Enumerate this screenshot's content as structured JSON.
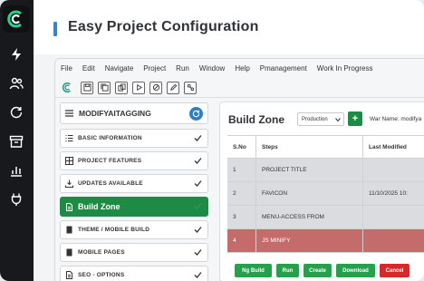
{
  "header": {
    "title": "Easy Project Configuration"
  },
  "menubar": [
    "File",
    "Edit",
    "Navigate",
    "Project",
    "Run",
    "Window",
    "Help",
    "Pmanagement",
    "Work In Progress"
  ],
  "sidebar": {
    "project_name": "MODIFYAITAGGING",
    "items": [
      {
        "label": "BASIC INFORMATION",
        "icon": "list-icon"
      },
      {
        "label": "PROJECT FEATURES",
        "icon": "grid-icon"
      },
      {
        "label": "UPDATES AVAILABLE",
        "icon": "download-icon"
      },
      {
        "label": "Build Zone",
        "icon": "document-icon",
        "active": true
      },
      {
        "label": "THEME / MOBILE BUILD",
        "icon": "document-icon"
      },
      {
        "label": "MOBILE PAGES",
        "icon": "document-icon"
      },
      {
        "label": "SEO - OPTIONS",
        "icon": "document-icon"
      }
    ]
  },
  "main": {
    "title": "Build Zone",
    "environment_select": "Production",
    "add_label": "+",
    "war_name_label": "War Name: modifya",
    "table": {
      "headers": [
        "S.No",
        "Steps",
        "Last Modified"
      ],
      "rows": [
        {
          "sno": "1",
          "step": "PROJECT TITLE",
          "modified": "",
          "status": "gray"
        },
        {
          "sno": "2",
          "step": "FAVICON",
          "modified": "11/10/2025 10:",
          "status": "gray"
        },
        {
          "sno": "3",
          "step": "MENU-ACCESS FROM",
          "modified": "",
          "status": "gray"
        },
        {
          "sno": "4",
          "step": "JS MINIFY",
          "modified": "",
          "status": "red"
        }
      ]
    },
    "actions": {
      "ng_build": "Ng Build",
      "run": "Run",
      "create": "Create",
      "download": "Download",
      "cancel": "Cancel"
    }
  },
  "colors": {
    "accent_green": "#1f8a46",
    "error_red": "#c46c6c",
    "brand_blue": "#2c7fc4",
    "rail_dark": "#17191c"
  }
}
